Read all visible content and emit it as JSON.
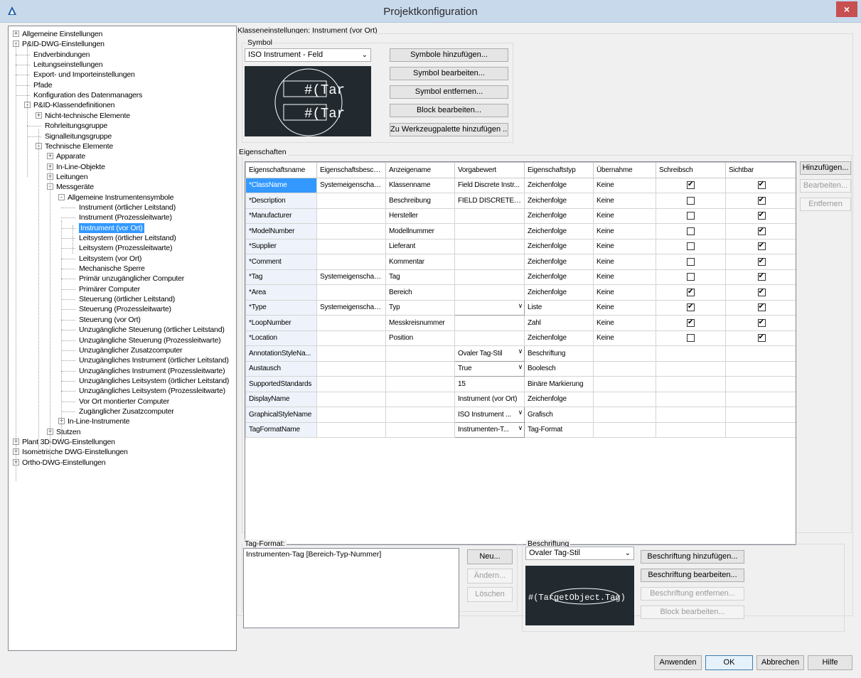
{
  "window": {
    "title": "Projektkonfiguration",
    "close": "×"
  },
  "tree": [
    {
      "label": "Allgemeine Einstellungen",
      "indent": 0,
      "box": "+"
    },
    {
      "label": "P&ID-DWG-Einstellungen",
      "indent": 0,
      "box": "-"
    },
    {
      "label": "Endverbindungen",
      "indent": 1
    },
    {
      "label": "Leitungseinstellungen",
      "indent": 1
    },
    {
      "label": "Export- und Importeinstellungen",
      "indent": 1
    },
    {
      "label": "Pfade",
      "indent": 1
    },
    {
      "label": "Konfiguration des Datenmanagers",
      "indent": 1
    },
    {
      "label": "P&ID-Klassendefinitionen",
      "indent": 1,
      "box": "-"
    },
    {
      "label": "Nicht-technische Elemente",
      "indent": 2,
      "box": "+"
    },
    {
      "label": "Rohrleitungsgruppe",
      "indent": 2
    },
    {
      "label": "Signalleitungsgruppe",
      "indent": 2
    },
    {
      "label": "Technische Elemente",
      "indent": 2,
      "box": "-"
    },
    {
      "label": "Apparate",
      "indent": 3,
      "box": "+"
    },
    {
      "label": "In-Line-Objekte",
      "indent": 3,
      "box": "+"
    },
    {
      "label": "Leitungen",
      "indent": 3,
      "box": "+"
    },
    {
      "label": "Messgeräte",
      "indent": 3,
      "box": "-"
    },
    {
      "label": "Allgemeine Instrumentensymbole",
      "indent": 4,
      "box": "-"
    },
    {
      "label": "Instrument (örtlicher Leitstand)",
      "indent": 5
    },
    {
      "label": "Instrument (Prozessleitwarte)",
      "indent": 5
    },
    {
      "label": "Instrument (vor Ort)",
      "indent": 5,
      "selected": true
    },
    {
      "label": "Leitsystem (örtlicher Leitstand)",
      "indent": 5
    },
    {
      "label": "Leitsystem (Prozessleitwarte)",
      "indent": 5
    },
    {
      "label": "Leitsystem (vor Ort)",
      "indent": 5
    },
    {
      "label": "Mechanische Sperre",
      "indent": 5
    },
    {
      "label": "Primär unzugänglicher Computer",
      "indent": 5
    },
    {
      "label": "Primärer Computer",
      "indent": 5
    },
    {
      "label": "Steuerung (örtlicher Leitstand)",
      "indent": 5
    },
    {
      "label": "Steuerung (Prozessleitwarte)",
      "indent": 5
    },
    {
      "label": "Steuerung (vor Ort)",
      "indent": 5
    },
    {
      "label": "Unzugängliche Steuerung (örtlicher Leitstand)",
      "indent": 5
    },
    {
      "label": "Unzugängliche Steuerung (Prozessleitwarte)",
      "indent": 5
    },
    {
      "label": "Unzugänglicher Zusatzcomputer",
      "indent": 5
    },
    {
      "label": "Unzugängliches Instrument (örtlicher Leitstand)",
      "indent": 5
    },
    {
      "label": "Unzugängliches Instrument (Prozessleitwarte)",
      "indent": 5
    },
    {
      "label": "Unzugängliches Leitsystem (örtlicher Leitstand)",
      "indent": 5
    },
    {
      "label": "Unzugängliches Leitsystem (Prozessleitwarte)",
      "indent": 5
    },
    {
      "label": "Vor Ort montierter Computer",
      "indent": 5
    },
    {
      "label": "Zugänglicher Zusatzcomputer",
      "indent": 5
    },
    {
      "label": "In-Line-Instrumente",
      "indent": 4,
      "box": "+"
    },
    {
      "label": "Stutzen",
      "indent": 3,
      "box": "+"
    },
    {
      "label": "Plant 3D-DWG-Einstellungen",
      "indent": 0,
      "box": "+"
    },
    {
      "label": "Isometrische DWG-Einstellungen",
      "indent": 0,
      "box": "+"
    },
    {
      "label": "Ortho-DWG-Einstellungen",
      "indent": 0,
      "box": "+"
    }
  ],
  "class_settings": {
    "title": "Klasseneinstellungen: Instrument (vor Ort)"
  },
  "symbol": {
    "group_label": "Symbol",
    "selected": "ISO Instrument - Feld",
    "buttons": [
      "Symbole hinzufügen...",
      "Symbol bearbeiten...",
      "Symbol entfernen...",
      "Block bearbeiten...",
      "Zu Werkzeugpalette hinzufügen ..."
    ],
    "preview_text_1": "#(Tar",
    "preview_text_2": "#(Tar"
  },
  "properties": {
    "group_label": "Eigenschaften",
    "columns": [
      "Eigenschaftsname",
      "Eigenschaftsbeschrei",
      "Anzeigename",
      "Vorgabewert",
      "Eigenschaftstyp",
      "Übernahme",
      "Schreibsch",
      "Sichtbar"
    ],
    "rows": [
      {
        "name": "*ClassName",
        "desc": "Systemeigenschaft,...",
        "display": "Klassenname",
        "default": "Field Discrete Instr...",
        "type": "Zeichenfolge",
        "inherit": "Keine",
        "readonly": true,
        "visible": true,
        "selected": true
      },
      {
        "name": "*Description",
        "desc": "",
        "display": "Beschreibung",
        "default": "FIELD DISCRETE ...",
        "type": "Zeichenfolge",
        "inherit": "Keine",
        "readonly": false,
        "visible": true
      },
      {
        "name": "*Manufacturer",
        "desc": "",
        "display": "Hersteller",
        "default": "",
        "type": "Zeichenfolge",
        "inherit": "Keine",
        "readonly": false,
        "visible": true
      },
      {
        "name": "*ModelNumber",
        "desc": "",
        "display": "Modellnummer",
        "default": "",
        "type": "Zeichenfolge",
        "inherit": "Keine",
        "readonly": false,
        "visible": true
      },
      {
        "name": "*Supplier",
        "desc": "",
        "display": "Lieferant",
        "default": "",
        "type": "Zeichenfolge",
        "inherit": "Keine",
        "readonly": false,
        "visible": true
      },
      {
        "name": "*Comment",
        "desc": "",
        "display": "Kommentar",
        "default": "",
        "type": "Zeichenfolge",
        "inherit": "Keine",
        "readonly": false,
        "visible": true
      },
      {
        "name": "*Tag",
        "desc": "Systemeigenschaft,...",
        "display": "Tag",
        "default": "",
        "type": "Zeichenfolge",
        "inherit": "Keine",
        "readonly": false,
        "visible": true
      },
      {
        "name": "*Area",
        "desc": "",
        "display": "Bereich",
        "default": "",
        "type": "Zeichenfolge",
        "inherit": "Keine",
        "readonly": true,
        "visible": true
      },
      {
        "name": "*Type",
        "desc": "Systemeigenschaft,...",
        "display": "Typ",
        "default": "",
        "type": "Liste",
        "inherit": "Keine",
        "readonly": true,
        "visible": true,
        "combo": true
      },
      {
        "name": "*LoopNumber",
        "desc": "",
        "display": "Messkreisnummer",
        "default": "",
        "type": "Zahl",
        "inherit": "Keine",
        "readonly": true,
        "visible": true
      },
      {
        "name": "*Location",
        "desc": "",
        "display": "Position",
        "default": "",
        "type": "Zeichenfolge",
        "inherit": "Keine",
        "readonly": false,
        "visible": true
      },
      {
        "name": "AnnotationStyleNa...",
        "desc": "",
        "display": "",
        "default": "Ovaler Tag-Stil",
        "type": "Beschriftung",
        "inherit": "",
        "combo": true
      },
      {
        "name": "Austausch",
        "desc": "",
        "display": "",
        "default": "True",
        "type": "Boolesch",
        "inherit": "",
        "combo": true
      },
      {
        "name": "SupportedStandards",
        "desc": "",
        "display": "",
        "default": "15",
        "type": "Binäre Markierung",
        "inherit": ""
      },
      {
        "name": "DisplayName",
        "desc": "",
        "display": "",
        "default": "Instrument (vor Ort)",
        "type": "Zeichenfolge",
        "inherit": ""
      },
      {
        "name": "GraphicalStyleName",
        "desc": "",
        "display": "",
        "default": "ISO Instrument ...",
        "type": "Grafisch",
        "inherit": "",
        "combo": true
      },
      {
        "name": "TagFormatName",
        "desc": "",
        "display": "",
        "default": "Instrumenten-T...",
        "type": "Tag-Format",
        "inherit": "",
        "combo": true
      }
    ],
    "buttons": {
      "add": "Hinzufügen...",
      "edit": "Bearbeiten...",
      "remove": "Entfernen"
    }
  },
  "tag_format": {
    "label": "Tag-Format:",
    "value": "Instrumenten-Tag [Bereich-Typ-Nummer]",
    "new": "Neu...",
    "change": "Ändern...",
    "delete": "Löschen"
  },
  "annotation": {
    "label": "Beschriftung",
    "selected": "Ovaler Tag-Stil",
    "add": "Beschriftung hinzufügen...",
    "edit": "Beschriftung bearbeiten...",
    "remove": "Beschriftung entfernen...",
    "block": "Block bearbeiten...",
    "preview_text": "#(TargetObject.Tag)"
  },
  "footer": {
    "apply": "Anwenden",
    "ok": "OK",
    "cancel": "Abbrechen",
    "help": "Hilfe"
  }
}
